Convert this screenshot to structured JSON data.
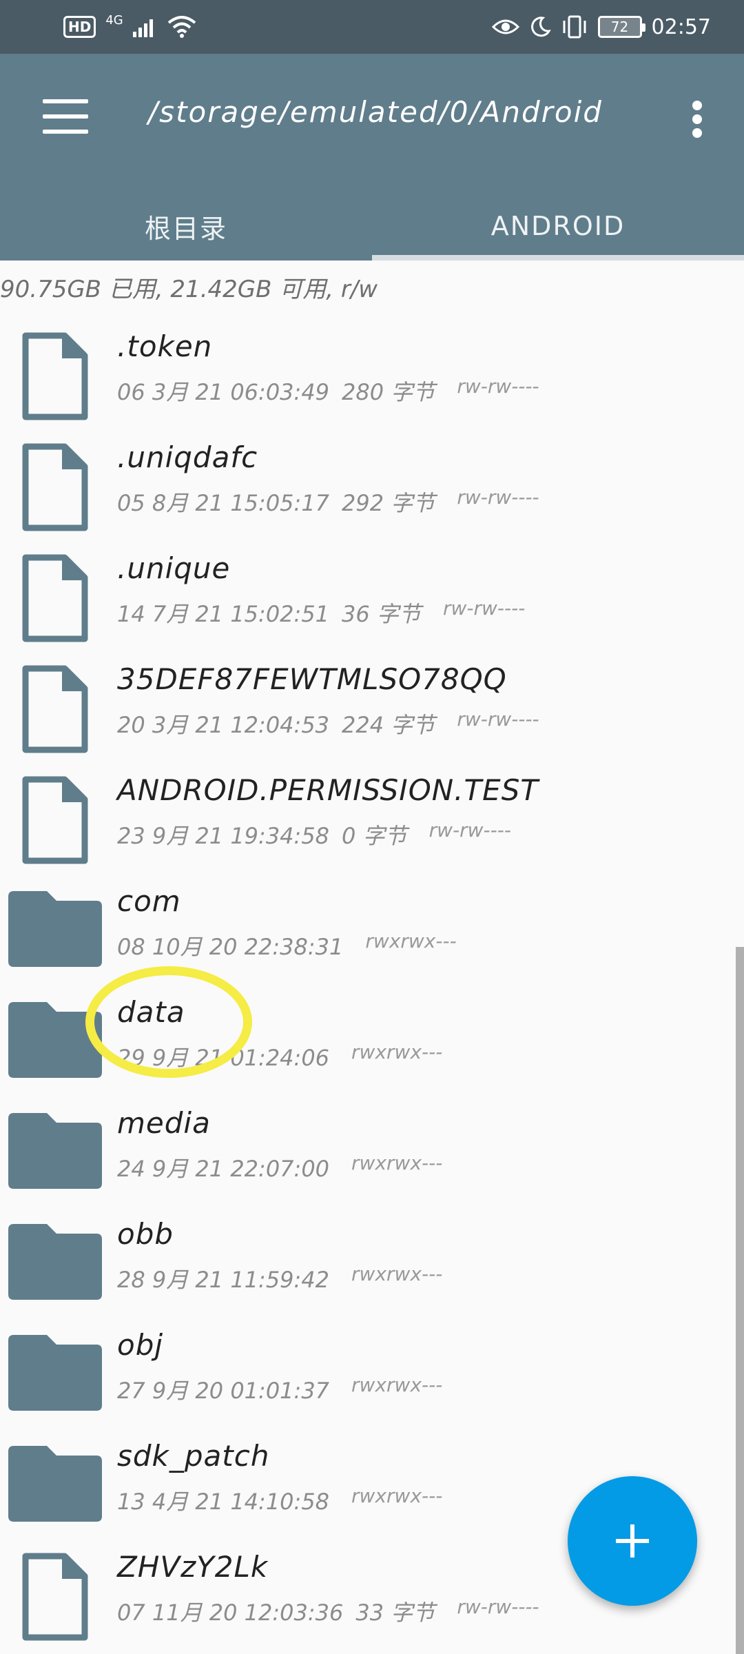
{
  "status_bar": {
    "hd": "HD",
    "network": "4G",
    "battery": "72",
    "time": "02:57"
  },
  "app_bar": {
    "path": "/storage/emulated/0/Android",
    "tabs": [
      {
        "label": "根目录",
        "active": false
      },
      {
        "label": "ANDROID",
        "active": true
      }
    ]
  },
  "storage_info": "90.75GB 已用, 21.42GB 可用, r/w",
  "files": [
    {
      "type": "file",
      "name": ".token",
      "date": "06 3月 21 06:03:49",
      "size": "280 字节",
      "perms": "rw-rw----"
    },
    {
      "type": "file",
      "name": ".uniqdafc",
      "date": "05 8月 21 15:05:17",
      "size": "292 字节",
      "perms": "rw-rw----"
    },
    {
      "type": "file",
      "name": ".unique",
      "date": "14 7月 21 15:02:51",
      "size": "36 字节",
      "perms": "rw-rw----"
    },
    {
      "type": "file",
      "name": "35DEF87FEWTMLSO78QQ",
      "date": "20 3月 21 12:04:53",
      "size": "224 字节",
      "perms": "rw-rw----"
    },
    {
      "type": "file",
      "name": "ANDROID.PERMISSION.TEST",
      "date": "23 9月 21 19:34:58",
      "size": "0 字节",
      "perms": "rw-rw----"
    },
    {
      "type": "folder",
      "name": "com",
      "date": "08 10月 20 22:38:31",
      "size": "",
      "perms": "rwxrwx---"
    },
    {
      "type": "folder",
      "name": "data",
      "date": "29 9月 21 01:24:06",
      "size": "",
      "perms": "rwxrwx---"
    },
    {
      "type": "folder",
      "name": "media",
      "date": "24 9月 21 22:07:00",
      "size": "",
      "perms": "rwxrwx---"
    },
    {
      "type": "folder",
      "name": "obb",
      "date": "28 9月 21 11:59:42",
      "size": "",
      "perms": "rwxrwx---"
    },
    {
      "type": "folder",
      "name": "obj",
      "date": "27 9月 20 01:01:37",
      "size": "",
      "perms": "rwxrwx---"
    },
    {
      "type": "folder",
      "name": "sdk_patch",
      "date": "13 4月 21 14:10:58",
      "size": "",
      "perms": "rwxrwx---"
    },
    {
      "type": "file",
      "name": "ZHVzY2Lk",
      "date": "07 11月 20 12:03:36",
      "size": "33 字节",
      "perms": "rw-rw----"
    }
  ],
  "icons": {
    "file": "file-icon",
    "folder": "folder-icon",
    "fab": "plus-icon"
  },
  "colors": {
    "app_bar": "#607d8b",
    "status_bar": "#4a5b65",
    "icon": "#607d8b",
    "fab": "#039be5",
    "highlight": "#f5ec45"
  }
}
